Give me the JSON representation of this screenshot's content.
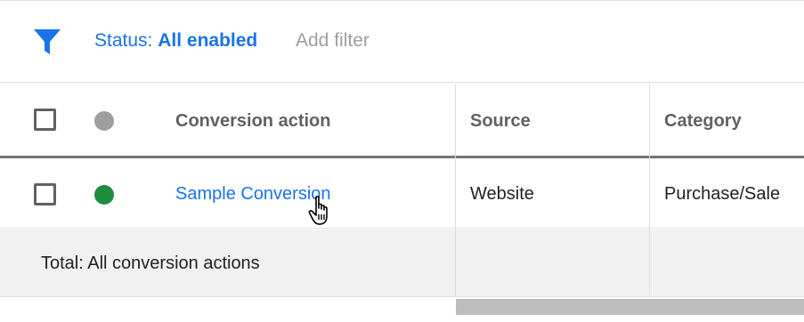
{
  "filter_bar": {
    "icon": "filter-icon",
    "status_label": "Status:",
    "status_value": "All enabled",
    "add_filter": "Add filter"
  },
  "table": {
    "columns": [
      "Conversion action",
      "Source",
      "Category"
    ],
    "header_status_color": "#9e9e9e",
    "rows": [
      {
        "status_color": "#1e8e3e",
        "conversion_action": "Sample Conversion",
        "source": "Website",
        "category": "Purchase/Sale"
      }
    ],
    "total_label": "Total: All conversion actions"
  },
  "colors": {
    "accent": "#1a73e8",
    "enabled_status": "#1e8e3e"
  }
}
